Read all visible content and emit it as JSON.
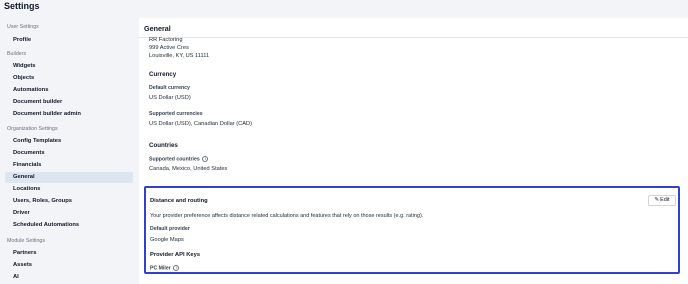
{
  "page": {
    "title": "Settings"
  },
  "sidebar": {
    "sections": [
      {
        "label": "User Settings",
        "items": [
          {
            "label": "Profile"
          }
        ]
      },
      {
        "label": "Builders",
        "items": [
          {
            "label": "Widgets"
          },
          {
            "label": "Objects"
          },
          {
            "label": "Automations"
          },
          {
            "label": "Document builder"
          },
          {
            "label": "Document builder admin"
          }
        ]
      },
      {
        "label": "Organization Settings",
        "items": [
          {
            "label": "Config Templates"
          },
          {
            "label": "Documents"
          },
          {
            "label": "Financials"
          },
          {
            "label": "General",
            "active": true
          },
          {
            "label": "Locations"
          },
          {
            "label": "Users, Roles, Groups"
          },
          {
            "label": "Driver"
          },
          {
            "label": "Scheduled Automations"
          }
        ]
      },
      {
        "label": "Module Settings",
        "items": [
          {
            "label": "Partners"
          },
          {
            "label": "Assets"
          },
          {
            "label": "AI"
          }
        ]
      }
    ]
  },
  "main": {
    "title": "General",
    "address": {
      "line1": "RR Factoring",
      "line2": "999 Active Cres",
      "line3": "Louisville, KY, US 11111"
    },
    "currency": {
      "heading": "Currency",
      "default_label": "Default currency",
      "default_value": "US Dollar (USD)",
      "supported_label": "Supported currencies",
      "supported_value": "US Dollar (USD), Canadian Dollar (CAD)"
    },
    "countries": {
      "heading": "Countries",
      "supported_label": "Supported countries",
      "supported_value": "Canada, Mexico, United States"
    }
  },
  "routing": {
    "title": "Distance and routing",
    "edit_label": "Edit",
    "description": "Your provider preference affects distance related calculations and features that rely on those results (e.g. rating).",
    "default_provider_label": "Default provider",
    "default_provider_value": "Google Maps",
    "api_keys_heading": "Provider API Keys",
    "pc_miler_label": "PC Miler"
  }
}
